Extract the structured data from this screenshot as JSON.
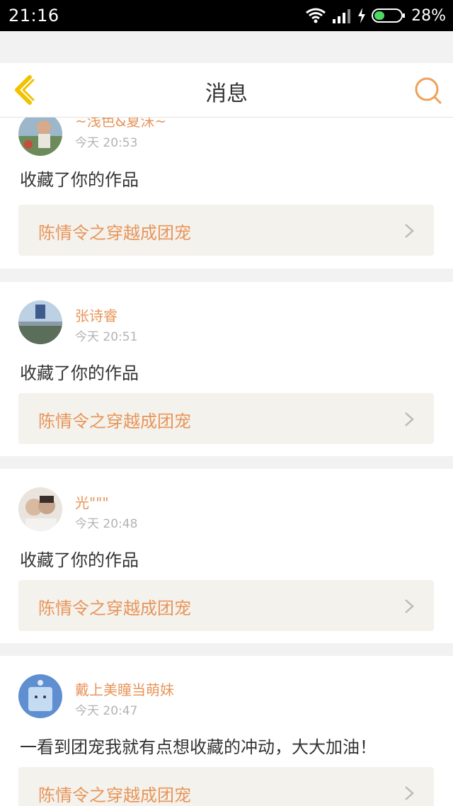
{
  "status_bar": {
    "time": "21:16",
    "battery": "28%"
  },
  "header": {
    "title": "消息"
  },
  "messages": [
    {
      "user": "~浅色&夏沫~",
      "time": "今天 20:53",
      "text": "收藏了你的作品",
      "work": "陈情令之穿越成团宠"
    },
    {
      "user": "张诗睿",
      "time": "今天 20:51",
      "text": "收藏了你的作品",
      "work": "陈情令之穿越成团宠"
    },
    {
      "user": "光\"\"\"",
      "time": "今天 20:48",
      "text": "收藏了你的作品",
      "work": "陈情令之穿越成团宠"
    },
    {
      "user": "戴上美瞳当萌妹",
      "time": "今天 20:47",
      "text": "一看到团宠我就有点想收藏的冲动，大大加油！",
      "work": "陈情令之穿越成团宠"
    }
  ],
  "colors": {
    "accent": "#e8955a",
    "back_icon": "#f2c200",
    "link_bg": "#f4f2ec"
  }
}
